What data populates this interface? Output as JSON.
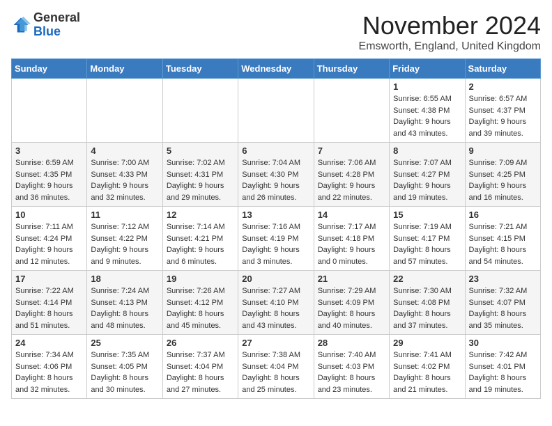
{
  "header": {
    "logo_line1": "General",
    "logo_line2": "Blue",
    "month": "November 2024",
    "location": "Emsworth, England, United Kingdom"
  },
  "weekdays": [
    "Sunday",
    "Monday",
    "Tuesday",
    "Wednesday",
    "Thursday",
    "Friday",
    "Saturday"
  ],
  "weeks": [
    [
      {
        "day": "",
        "info": ""
      },
      {
        "day": "",
        "info": ""
      },
      {
        "day": "",
        "info": ""
      },
      {
        "day": "",
        "info": ""
      },
      {
        "day": "",
        "info": ""
      },
      {
        "day": "1",
        "info": "Sunrise: 6:55 AM\nSunset: 4:38 PM\nDaylight: 9 hours\nand 43 minutes."
      },
      {
        "day": "2",
        "info": "Sunrise: 6:57 AM\nSunset: 4:37 PM\nDaylight: 9 hours\nand 39 minutes."
      }
    ],
    [
      {
        "day": "3",
        "info": "Sunrise: 6:59 AM\nSunset: 4:35 PM\nDaylight: 9 hours\nand 36 minutes."
      },
      {
        "day": "4",
        "info": "Sunrise: 7:00 AM\nSunset: 4:33 PM\nDaylight: 9 hours\nand 32 minutes."
      },
      {
        "day": "5",
        "info": "Sunrise: 7:02 AM\nSunset: 4:31 PM\nDaylight: 9 hours\nand 29 minutes."
      },
      {
        "day": "6",
        "info": "Sunrise: 7:04 AM\nSunset: 4:30 PM\nDaylight: 9 hours\nand 26 minutes."
      },
      {
        "day": "7",
        "info": "Sunrise: 7:06 AM\nSunset: 4:28 PM\nDaylight: 9 hours\nand 22 minutes."
      },
      {
        "day": "8",
        "info": "Sunrise: 7:07 AM\nSunset: 4:27 PM\nDaylight: 9 hours\nand 19 minutes."
      },
      {
        "day": "9",
        "info": "Sunrise: 7:09 AM\nSunset: 4:25 PM\nDaylight: 9 hours\nand 16 minutes."
      }
    ],
    [
      {
        "day": "10",
        "info": "Sunrise: 7:11 AM\nSunset: 4:24 PM\nDaylight: 9 hours\nand 12 minutes."
      },
      {
        "day": "11",
        "info": "Sunrise: 7:12 AM\nSunset: 4:22 PM\nDaylight: 9 hours\nand 9 minutes."
      },
      {
        "day": "12",
        "info": "Sunrise: 7:14 AM\nSunset: 4:21 PM\nDaylight: 9 hours\nand 6 minutes."
      },
      {
        "day": "13",
        "info": "Sunrise: 7:16 AM\nSunset: 4:19 PM\nDaylight: 9 hours\nand 3 minutes."
      },
      {
        "day": "14",
        "info": "Sunrise: 7:17 AM\nSunset: 4:18 PM\nDaylight: 9 hours\nand 0 minutes."
      },
      {
        "day": "15",
        "info": "Sunrise: 7:19 AM\nSunset: 4:17 PM\nDaylight: 8 hours\nand 57 minutes."
      },
      {
        "day": "16",
        "info": "Sunrise: 7:21 AM\nSunset: 4:15 PM\nDaylight: 8 hours\nand 54 minutes."
      }
    ],
    [
      {
        "day": "17",
        "info": "Sunrise: 7:22 AM\nSunset: 4:14 PM\nDaylight: 8 hours\nand 51 minutes."
      },
      {
        "day": "18",
        "info": "Sunrise: 7:24 AM\nSunset: 4:13 PM\nDaylight: 8 hours\nand 48 minutes."
      },
      {
        "day": "19",
        "info": "Sunrise: 7:26 AM\nSunset: 4:12 PM\nDaylight: 8 hours\nand 45 minutes."
      },
      {
        "day": "20",
        "info": "Sunrise: 7:27 AM\nSunset: 4:10 PM\nDaylight: 8 hours\nand 43 minutes."
      },
      {
        "day": "21",
        "info": "Sunrise: 7:29 AM\nSunset: 4:09 PM\nDaylight: 8 hours\nand 40 minutes."
      },
      {
        "day": "22",
        "info": "Sunrise: 7:30 AM\nSunset: 4:08 PM\nDaylight: 8 hours\nand 37 minutes."
      },
      {
        "day": "23",
        "info": "Sunrise: 7:32 AM\nSunset: 4:07 PM\nDaylight: 8 hours\nand 35 minutes."
      }
    ],
    [
      {
        "day": "24",
        "info": "Sunrise: 7:34 AM\nSunset: 4:06 PM\nDaylight: 8 hours\nand 32 minutes."
      },
      {
        "day": "25",
        "info": "Sunrise: 7:35 AM\nSunset: 4:05 PM\nDaylight: 8 hours\nand 30 minutes."
      },
      {
        "day": "26",
        "info": "Sunrise: 7:37 AM\nSunset: 4:04 PM\nDaylight: 8 hours\nand 27 minutes."
      },
      {
        "day": "27",
        "info": "Sunrise: 7:38 AM\nSunset: 4:04 PM\nDaylight: 8 hours\nand 25 minutes."
      },
      {
        "day": "28",
        "info": "Sunrise: 7:40 AM\nSunset: 4:03 PM\nDaylight: 8 hours\nand 23 minutes."
      },
      {
        "day": "29",
        "info": "Sunrise: 7:41 AM\nSunset: 4:02 PM\nDaylight: 8 hours\nand 21 minutes."
      },
      {
        "day": "30",
        "info": "Sunrise: 7:42 AM\nSunset: 4:01 PM\nDaylight: 8 hours\nand 19 minutes."
      }
    ]
  ]
}
